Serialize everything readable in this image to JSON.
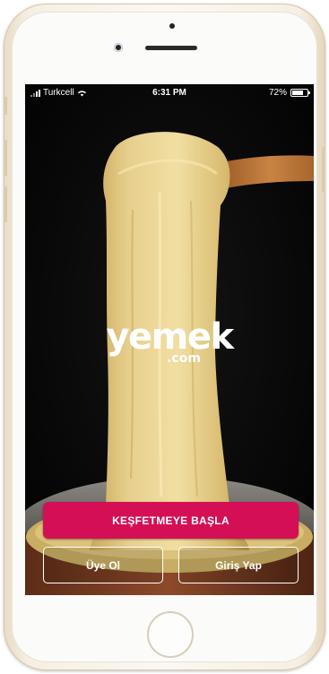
{
  "status_bar": {
    "carrier": "Turkcell",
    "time": "6:31 PM",
    "battery_percent": "72%",
    "battery_level": 0.72
  },
  "logo": {
    "brand": "yemek",
    "suffix": ".com"
  },
  "actions": {
    "start_label": "KEŞFETMEYE BAŞLA",
    "signup_label": "Üye Ol",
    "login_label": "Giriş Yap"
  },
  "colors": {
    "accent": "#d40f55",
    "background": "#040404",
    "phone_frame": "#f6efe3"
  },
  "icons": [
    "signal-bars-icon",
    "wifi-icon",
    "battery-icon"
  ]
}
